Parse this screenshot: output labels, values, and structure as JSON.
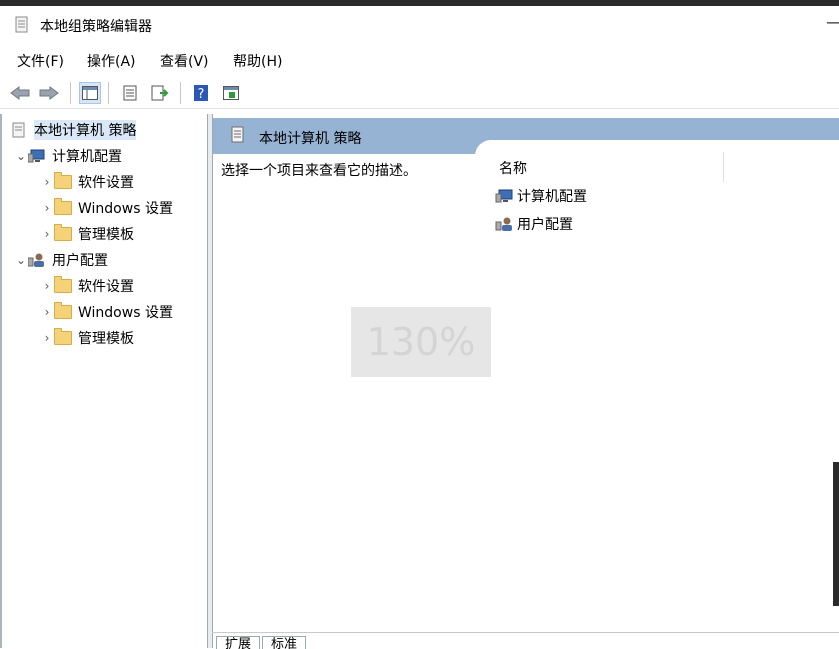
{
  "window": {
    "title": "本地组策略编辑器",
    "minimize_glyph": "—"
  },
  "menu": [
    "文件(F)",
    "操作(A)",
    "查看(V)",
    "帮助(H)"
  ],
  "toolbar": {
    "icons": [
      "back-arrow-icon",
      "forward-arrow-icon",
      "show-hide-tree-icon",
      "properties-icon",
      "export-list-icon",
      "help-icon",
      "show-hide-action-pane-icon"
    ]
  },
  "tree": {
    "root": "本地计算机 策略",
    "computer": {
      "label": "计算机配置",
      "children": [
        "软件设置",
        "Windows 设置",
        "管理模板"
      ]
    },
    "user": {
      "label": "用户配置",
      "children": [
        "软件设置",
        "Windows 设置",
        "管理模板"
      ]
    }
  },
  "right": {
    "title": "本地计算机 策略",
    "description": "选择一个项目来查看它的描述。",
    "column_name": "名称",
    "items": [
      "计算机配置",
      "用户配置"
    ]
  },
  "zoom_overlay": "130%",
  "tabs": [
    "扩展",
    "标准"
  ],
  "colors": {
    "header_band": "#97b3d3",
    "selection": "#d9e7f7",
    "folder": "#f3d27a"
  }
}
